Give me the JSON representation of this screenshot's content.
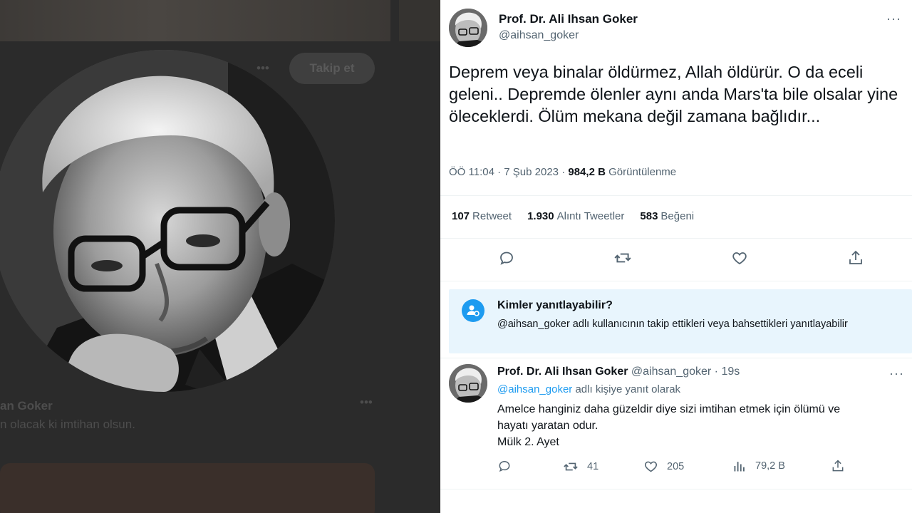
{
  "left_panel": {
    "follow_label": "Takip et",
    "ghost_name": "an Goker",
    "ghost_text": "n olacak ki imtihan olsun."
  },
  "tweet": {
    "author_name": "Prof. Dr. Ali Ihsan Goker",
    "author_handle": "@aihsan_goker",
    "text": "Deprem veya binalar öldürmez, Allah öldürür. O da eceli geleni.. Depremde ölenler aynı anda Mars'ta bile olsalar yine öleceklerdi. Ölüm mekana değil zamana bağlıdır...",
    "time": "ÖÖ 11:04",
    "date": "7 Şub 2023",
    "views_count": "984,2 B",
    "views_label": "Görüntülenme",
    "retweet_count": "107",
    "retweet_label": "Retweet",
    "quote_count": "1.930",
    "quote_label": "Alıntı Tweetler",
    "like_count": "583",
    "like_label": "Beğeni",
    "icons": [
      "comment-icon",
      "retweet-icon",
      "heart-icon",
      "share-icon"
    ]
  },
  "reply_restriction": {
    "title": "Kimler yanıtlayabilir?",
    "description": "@aihsan_goker adlı kullanıcının takip ettikleri veya bahsettikleri yanıtlayabilir",
    "icon": "person-at-icon"
  },
  "reply_tweet": {
    "author_name": "Prof. Dr. Ali Ihsan Goker",
    "author_handle": "@aihsan_goker",
    "time_ago": "19s",
    "replying_mention": "@aihsan_goker",
    "replying_suffix": "adlı kişiye yanıt olarak",
    "line1": "Amelce hanginiz daha güzeldir diye sizi imtihan etmek için ölümü ve",
    "line2": "hayatı yaratan odur.",
    "line3": "Mülk 2. Ayet",
    "retweets": "41",
    "likes": "205",
    "views": "79,2 B"
  },
  "colors": {
    "accent": "#1d9bf0",
    "secondary_text": "#536471",
    "reply_box_bg": "#e8f5fd",
    "left_bg": "#2b2b2b"
  }
}
